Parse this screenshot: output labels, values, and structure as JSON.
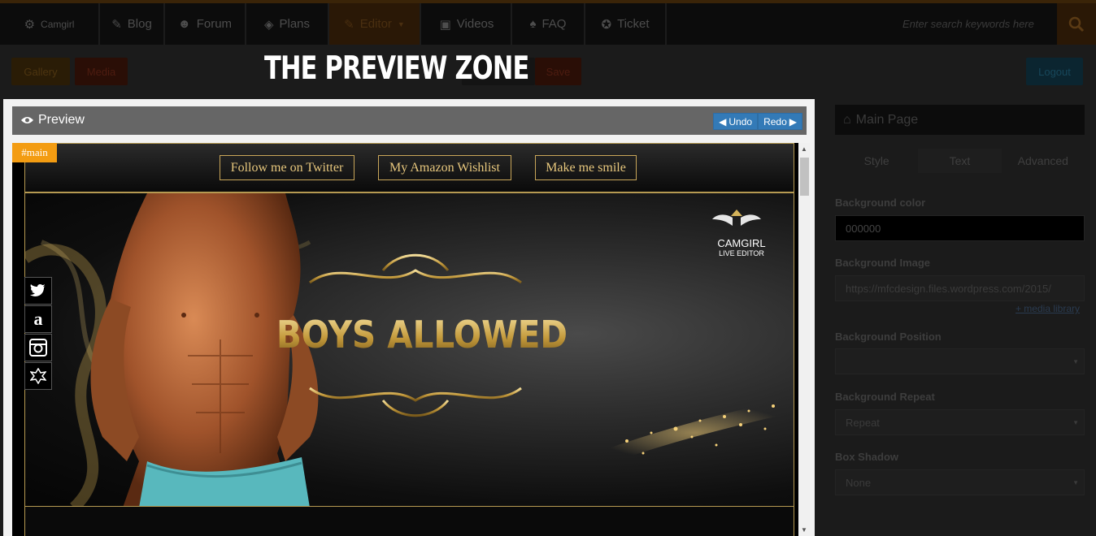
{
  "nav": {
    "items": [
      {
        "label": "Camgirl",
        "icon": "logo-icon"
      },
      {
        "label": "Blog",
        "icon": "edit-icon"
      },
      {
        "label": "Forum",
        "icon": "users-icon"
      },
      {
        "label": "Plans",
        "icon": "layers-icon"
      },
      {
        "label": "Editor",
        "icon": "pencil-icon"
      },
      {
        "label": "Videos",
        "icon": "video-icon"
      },
      {
        "label": "FAQ",
        "icon": "lightbulb-icon"
      },
      {
        "label": "Ticket",
        "icon": "lifebuoy-icon"
      }
    ],
    "search_placeholder": "Enter search keywords here"
  },
  "toolbar": {
    "gallery": "Gallery",
    "media": "Media",
    "save": "Save",
    "logout": "Logout"
  },
  "zone_title": "THE PREVIEW ZONE",
  "preview": {
    "label": "Preview",
    "undo": "Undo",
    "redo": "Redo",
    "main_tag": "#main",
    "menu": [
      "Follow me on Twitter",
      "My Amazon Wishlist",
      "Make me smile"
    ],
    "banner_title": "BOYS ALLOWED",
    "logo_line1": "CAMGIRL",
    "logo_line2": "LIVE EDITOR",
    "social": [
      "twitter-icon",
      "amazon-icon",
      "instagram-icon",
      "crest-icon"
    ]
  },
  "panel": {
    "title": "Main Page",
    "tabs": [
      "Style",
      "Text",
      "Advanced"
    ],
    "bg_color_label": "Background color",
    "bg_color_value": "000000",
    "bg_image_label": "Background Image",
    "bg_image_value": "https://mfcdesign.files.wordpress.com/2015/",
    "media_library": "+ media library",
    "bg_position_label": "Background Position",
    "bg_position_value": "",
    "bg_repeat_label": "Background Repeat",
    "bg_repeat_value": "Repeat",
    "box_shadow_label": "Box Shadow",
    "box_shadow_value": "None"
  },
  "colors": {
    "accent": "#f39c12",
    "gold": "#c9a659",
    "blue": "#337ab7"
  }
}
